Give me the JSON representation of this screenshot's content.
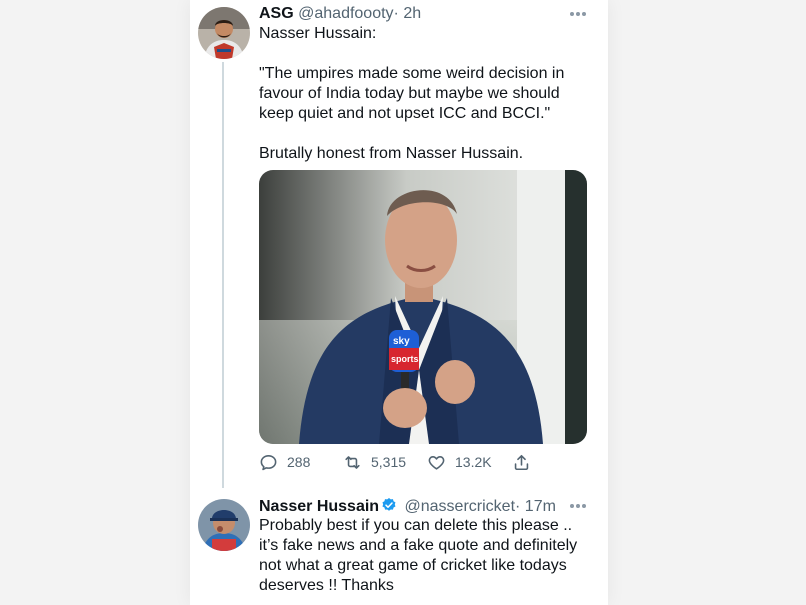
{
  "tweet1": {
    "name": "ASG",
    "handle": "@ahadfoooty",
    "time": "· 2h",
    "text": "Nasser Hussain:\n\n\"The umpires made some weird decision in favour of India today but maybe we should keep quiet and not upset ICC and BCCI.\"\n\nBrutally honest from Nasser Hussain.",
    "replies": "288",
    "retweets": "5,315",
    "likes": "13.2K",
    "mic_logo_line1": "sky",
    "mic_logo_line2": "sports"
  },
  "tweet2": {
    "name": "Nasser Hussain",
    "handle": "@nassercricket",
    "time": "· 17m",
    "text": "Probably best if you can delete this please .. it’s fake news and a fake quote and definitely not what a great game of cricket like todays deserves !! Thanks"
  },
  "icons": {
    "reply": "reply-icon",
    "retweet": "retweet-icon",
    "like": "like-icon",
    "share": "share-icon",
    "more": "more-icon",
    "verified": "verified-badge-icon"
  },
  "colors": {
    "verified": "#1d9bf0",
    "secondary_text": "#536471",
    "thread_line": "#cfd9de"
  }
}
